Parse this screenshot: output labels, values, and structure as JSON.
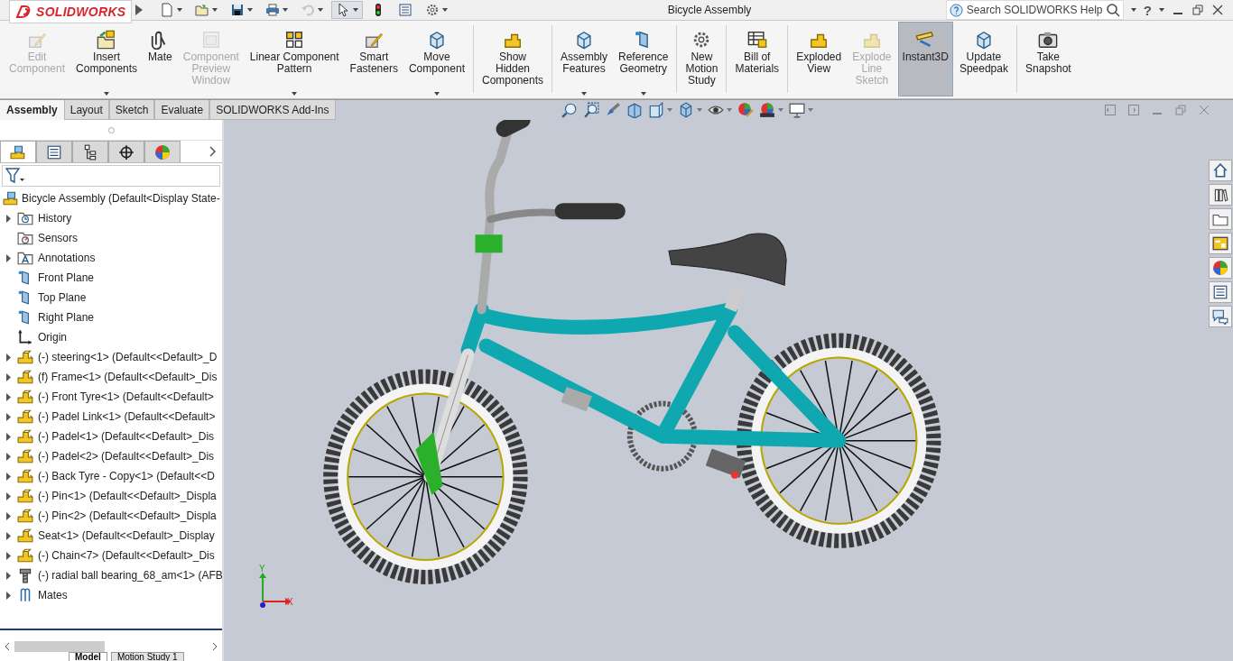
{
  "window": {
    "logo": "SOLIDWORKS",
    "title": "Bicycle Assembly",
    "search": {
      "placeholder": "Search SOLIDWORKS Help"
    },
    "help": "?"
  },
  "quick_access": [
    {
      "dropdown": true,
      "disabled": false,
      "selected": false
    },
    {
      "dropdown": true,
      "disabled": false,
      "selected": false
    },
    {
      "dropdown": true,
      "disabled": false,
      "selected": false
    },
    {
      "dropdown": true,
      "disabled": false,
      "selected": false
    },
    {
      "dropdown": true,
      "disabled": true,
      "selected": false
    },
    {
      "dropdown": true,
      "disabled": false,
      "selected": true
    },
    {
      "dropdown": false,
      "disabled": false,
      "selected": false
    },
    {
      "dropdown": false,
      "disabled": false,
      "selected": false
    },
    {
      "dropdown": true,
      "disabled": false,
      "selected": false
    }
  ],
  "ribbon": {
    "buttons": [
      {
        "lines": [
          "Edit",
          "Component"
        ],
        "disabled": true,
        "dropdown": false,
        "selected": false
      },
      {
        "lines": [
          "Insert",
          "Components"
        ],
        "disabled": false,
        "dropdown": true,
        "selected": false
      },
      {
        "lines": [
          "Mate"
        ],
        "disabled": false,
        "dropdown": false,
        "selected": false
      },
      {
        "lines": [
          "Component",
          "Preview",
          "Window"
        ],
        "disabled": true,
        "dropdown": false,
        "selected": false
      },
      {
        "lines": [
          "Linear Component",
          "Pattern"
        ],
        "disabled": false,
        "dropdown": true,
        "selected": false
      },
      {
        "lines": [
          "Smart",
          "Fasteners"
        ],
        "disabled": false,
        "dropdown": false,
        "selected": false
      },
      {
        "lines": [
          "Move",
          "Component"
        ],
        "disabled": false,
        "dropdown": true,
        "selected": false
      },
      {
        "lines": [
          "Show",
          "Hidden",
          "Components"
        ],
        "disabled": false,
        "dropdown": false,
        "selected": false
      },
      {
        "lines": [
          "Assembly",
          "Features"
        ],
        "disabled": false,
        "dropdown": true,
        "selected": false
      },
      {
        "lines": [
          "Reference",
          "Geometry"
        ],
        "disabled": false,
        "dropdown": true,
        "selected": false
      },
      {
        "lines": [
          "New",
          "Motion",
          "Study"
        ],
        "disabled": false,
        "dropdown": false,
        "selected": false
      },
      {
        "lines": [
          "Bill of",
          "Materials"
        ],
        "disabled": false,
        "dropdown": false,
        "selected": false
      },
      {
        "lines": [
          "Exploded",
          "View"
        ],
        "disabled": false,
        "dropdown": false,
        "selected": false
      },
      {
        "lines": [
          "Explode",
          "Line",
          "Sketch"
        ],
        "disabled": true,
        "dropdown": false,
        "selected": false
      },
      {
        "lines": [
          "Instant3D"
        ],
        "disabled": false,
        "dropdown": false,
        "selected": true
      },
      {
        "lines": [
          "Update",
          "Speedpak"
        ],
        "disabled": false,
        "dropdown": false,
        "selected": false
      },
      {
        "lines": [
          "Take",
          "Snapshot"
        ],
        "disabled": false,
        "dropdown": false,
        "selected": false
      }
    ]
  },
  "tabs": [
    {
      "label": "Assembly",
      "selected": true
    },
    {
      "label": "Layout",
      "selected": false
    },
    {
      "label": "Sketch",
      "selected": false
    },
    {
      "label": "Evaluate",
      "selected": false
    },
    {
      "label": "SOLIDWORKS Add-Ins",
      "selected": false
    }
  ],
  "panel_tabs": [
    {
      "selected": true
    },
    {
      "selected": false
    },
    {
      "selected": false
    },
    {
      "selected": false
    },
    {
      "selected": false
    }
  ],
  "tree": {
    "label": "Bicycle Assembly  (Default<Display State-",
    "kind": "assembly",
    "children": [
      {
        "label": "History",
        "kind": "history",
        "expanded": false
      },
      {
        "label": "Sensors",
        "kind": "sensor"
      },
      {
        "label": "Annotations",
        "kind": "annotation",
        "expanded": false
      },
      {
        "label": "Front Plane",
        "kind": "plane"
      },
      {
        "label": "Top Plane",
        "kind": "plane"
      },
      {
        "label": "Right Plane",
        "kind": "plane"
      },
      {
        "label": "Origin",
        "kind": "origin"
      },
      {
        "label": "(-) steering<1> (Default<<Default>_D",
        "kind": "part",
        "expanded": false
      },
      {
        "label": "(f) Frame<1> (Default<<Default>_Dis",
        "kind": "part",
        "expanded": false
      },
      {
        "label": "(-) Front Tyre<1> (Default<<Default>",
        "kind": "part",
        "expanded": false
      },
      {
        "label": "(-) Padel Link<1> (Default<<Default>",
        "kind": "part",
        "expanded": false
      },
      {
        "label": "(-) Padel<1> (Default<<Default>_Dis",
        "kind": "part",
        "expanded": false
      },
      {
        "label": "(-) Padel<2> (Default<<Default>_Dis",
        "kind": "part",
        "expanded": false
      },
      {
        "label": "(-) Back Tyre - Copy<1> (Default<<D",
        "kind": "part",
        "expanded": false
      },
      {
        "label": "(-) Pin<1> (Default<<Default>_Displa",
        "kind": "part",
        "expanded": false
      },
      {
        "label": "(-) Pin<2> (Default<<Default>_Displa",
        "kind": "part",
        "expanded": false
      },
      {
        "label": "Seat<1> (Default<<Default>_Display",
        "kind": "part",
        "expanded": false
      },
      {
        "label": "(-) Chain<7> (Default<<Default>_Dis",
        "kind": "part",
        "expanded": false
      },
      {
        "label": "(-) radial ball bearing_68_am<1> (AFB",
        "kind": "bolt",
        "expanded": false
      },
      {
        "label": "Mates",
        "kind": "mates",
        "expanded": false
      }
    ]
  },
  "bottom_tabs": [
    {
      "label": "Model",
      "selected": true
    },
    {
      "label": "Motion Study 1",
      "selected": false
    }
  ],
  "triad": {
    "y_label": "Y",
    "x_label": "X"
  }
}
